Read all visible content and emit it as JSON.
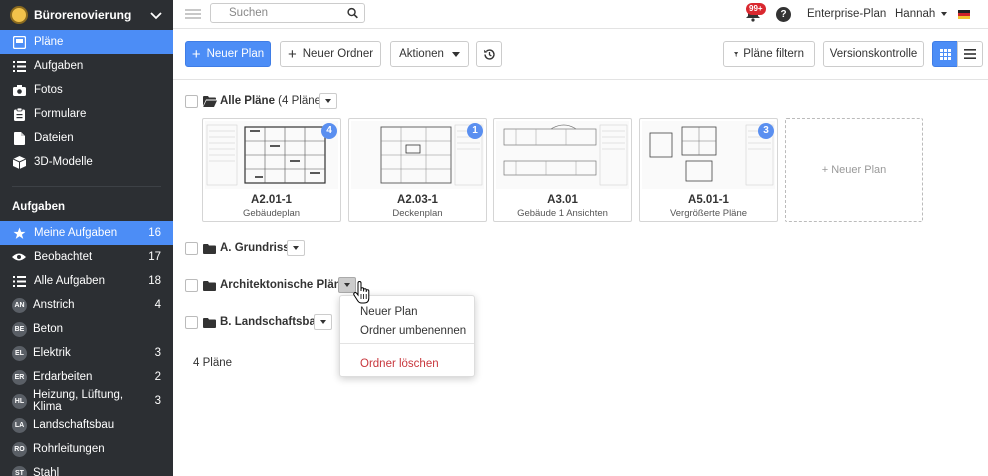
{
  "project": {
    "name": "Bürorenovierung"
  },
  "sidebar": {
    "nav": [
      {
        "label": "Pläne",
        "icon": "plans-icon",
        "active": true
      },
      {
        "label": "Aufgaben",
        "icon": "list-icon"
      },
      {
        "label": "Fotos",
        "icon": "camera-icon"
      },
      {
        "label": "Formulare",
        "icon": "clipboard-icon"
      },
      {
        "label": "Dateien",
        "icon": "file-icon"
      },
      {
        "label": "3D-Modelle",
        "icon": "cube-icon"
      }
    ],
    "tasks_heading": "Aufgaben",
    "tasks": [
      {
        "label": "Meine Aufgaben",
        "count": "16",
        "icon": "star-icon",
        "active": true
      },
      {
        "label": "Beobachtet",
        "count": "17",
        "icon": "eye-icon"
      },
      {
        "label": "Alle Aufgaben",
        "count": "18",
        "icon": "list-icon"
      },
      {
        "label": "Anstrich",
        "count": "4",
        "initials": "AN"
      },
      {
        "label": "Beton",
        "count": "",
        "initials": "BE"
      },
      {
        "label": "Elektrik",
        "count": "3",
        "initials": "EL"
      },
      {
        "label": "Erdarbeiten",
        "count": "2",
        "initials": "ER"
      },
      {
        "label": "Heizung, Lüftung, Klima",
        "count": "3",
        "initials": "HL"
      },
      {
        "label": "Landschaftsbau",
        "count": "",
        "initials": "LA"
      },
      {
        "label": "Rohrleitungen",
        "count": "",
        "initials": "RO"
      },
      {
        "label": "Stahl",
        "count": "",
        "initials": "ST"
      }
    ]
  },
  "topbar": {
    "search_placeholder": "Suchen",
    "notification_badge": "99+",
    "help": "?",
    "plan": "Enterprise-Plan",
    "user": "Hannah"
  },
  "toolbar": {
    "new_plan": "Neuer Plan",
    "new_folder": "Neuer Ordner",
    "actions": "Aktionen",
    "filter": "Pläne filtern",
    "versions": "Versionskontrolle"
  },
  "all_plans": {
    "label": "Alle Pläne",
    "count_label": "(4 Pläne)",
    "cards": [
      {
        "title": "A2.01-1",
        "subtitle": "Gebäudeplan",
        "badge": "4"
      },
      {
        "title": "A2.03-1",
        "subtitle": "Deckenplan",
        "badge": "1"
      },
      {
        "title": "A3.01",
        "subtitle": "Gebäude 1 Ansichten",
        "badge": ""
      },
      {
        "title": "A5.01-1",
        "subtitle": "Vergrößerte Pläne",
        "badge": "3"
      }
    ],
    "add_card": "+ Neuer Plan"
  },
  "folders": [
    {
      "label": "A. Grundriss"
    },
    {
      "label": "Architektonische Pläne"
    },
    {
      "label": "B. Landschaftsbau"
    }
  ],
  "footer_count": "4 Pläne",
  "menu": {
    "new_plan": "Neuer Plan",
    "rename": "Ordner umbenennen",
    "delete": "Ordner löschen"
  },
  "colors": {
    "accent": "#4c8df6",
    "sidebar": "#2c2f33",
    "danger": "#c8373d",
    "badge_red": "#d9282f"
  }
}
